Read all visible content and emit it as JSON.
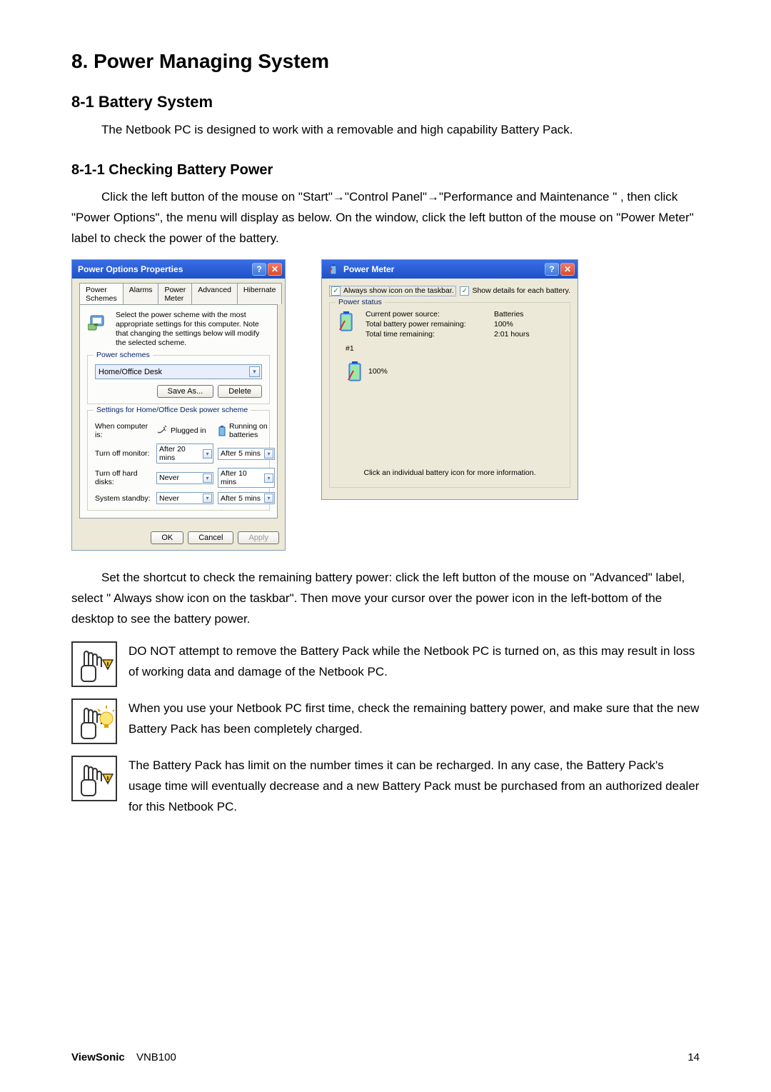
{
  "headings": {
    "h1": "8. Power Managing System",
    "h2": "8-1 Battery System",
    "h3": "8-1-1 Checking Battery Power"
  },
  "paragraphs": {
    "intro": "The Netbook PC is designed to work with a removable and high capability Battery Pack.",
    "check1": "Click the left button of the mouse on \"Start\"→\"Control Panel\"→\"Performance and Maintenance \" , then click \"Power Options\", the menu will display as below. On the window, click the left button of the mouse on \"Power Meter\" label to check the power of the battery.",
    "shortcut": "Set the shortcut to check the remaining battery power: click the left button of the mouse on \"Advanced\" label, select \" Always show icon on the taskbar\". Then move your cursor over the power icon in the left-bottom of the desktop to see the battery power.",
    "note1": "DO NOT attempt to remove the Battery Pack while the Netbook PC is turned on, as this may result in loss of working data and damage of the Netbook PC.",
    "note2": "When you use your Netbook PC first time, check the remaining battery power, and make sure that the new Battery Pack has been completely charged.",
    "note3": "The Battery Pack has limit on the number times it can be recharged. In any case, the Battery Pack's usage time will eventually decrease and a new Battery Pack must be purchased from an authorized dealer for this Netbook PC."
  },
  "power_options": {
    "title": "Power Options Properties",
    "tabs": [
      "Power Schemes",
      "Alarms",
      "Power Meter",
      "Advanced",
      "Hibernate"
    ],
    "active_tab": 0,
    "hint": "Select the power scheme with the most appropriate settings for this computer. Note that changing the settings below will modify the selected scheme.",
    "schemes_label": "Power schemes",
    "scheme_value": "Home/Office Desk",
    "save_as": "Save As...",
    "delete": "Delete",
    "settings_legend": "Settings for Home/Office Desk power scheme",
    "when_computer_is": "When computer is:",
    "plugged_in": "Plugged in",
    "running_on": "Running on batteries",
    "rows": [
      {
        "label": "Turn off monitor:",
        "plugged": "After 20 mins",
        "battery": "After 5 mins"
      },
      {
        "label": "Turn off hard disks:",
        "plugged": "Never",
        "battery": "After 10 mins"
      },
      {
        "label": "System standby:",
        "plugged": "Never",
        "battery": "After 5 mins"
      }
    ],
    "ok": "OK",
    "cancel": "Cancel",
    "apply": "Apply"
  },
  "power_meter": {
    "title": "Power Meter",
    "chk_taskbar": "Always show icon on the taskbar.",
    "chk_details": "Show details for each battery.",
    "status_legend": "Power status",
    "labels": {
      "source": "Current power source:",
      "remaining": "Total battery power remaining:",
      "time": "Total time remaining:"
    },
    "values": {
      "source": "Batteries",
      "remaining": "100%",
      "time": "2:01 hours"
    },
    "battery_num": "#1",
    "battery_pct": "100%",
    "bottom_hint": "Click an individual battery icon for more information."
  },
  "footer": {
    "brand": "ViewSonic",
    "model": "VNB100",
    "page": "14"
  }
}
